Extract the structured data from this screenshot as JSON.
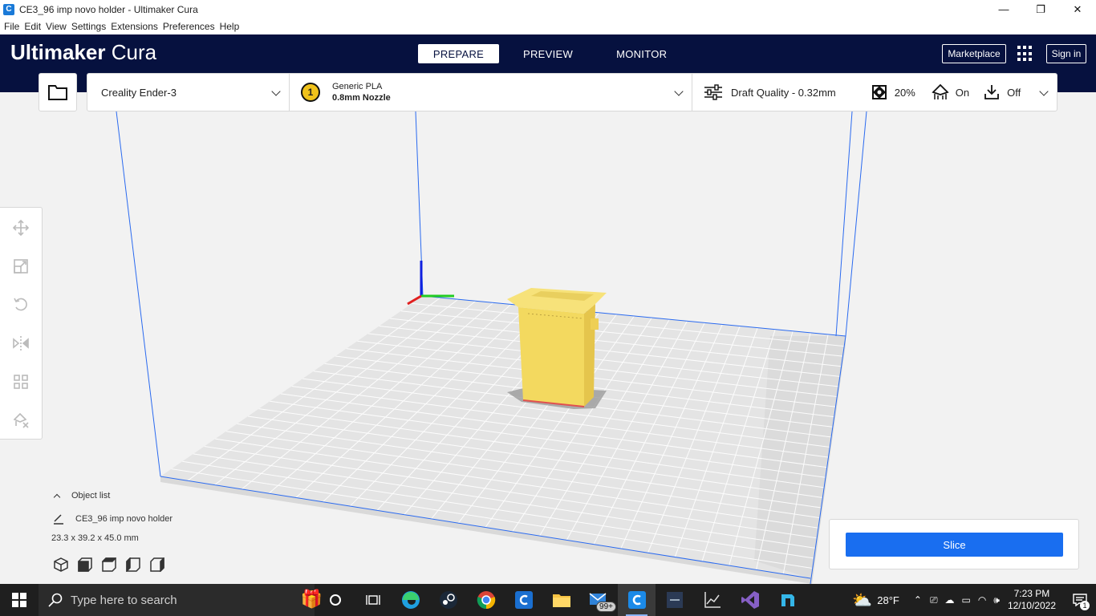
{
  "window": {
    "title": "CE3_96 imp novo holder - Ultimaker Cura",
    "minimize": "—",
    "maximize": "❐",
    "close": "✕"
  },
  "menu": {
    "items": [
      "File",
      "Edit",
      "View",
      "Settings",
      "Extensions",
      "Preferences",
      "Help"
    ]
  },
  "header": {
    "brand_bold": "Ultimaker",
    "brand_light": "Cura",
    "tabs": [
      "PREPARE",
      "PREVIEW",
      "MONITOR"
    ],
    "marketplace": "Marketplace",
    "sign_in": "Sign in"
  },
  "printer": {
    "name": "Creality Ender-3"
  },
  "material": {
    "extruder_number": "1",
    "name": "Generic PLA",
    "nozzle": "0.8mm Nozzle"
  },
  "print_settings": {
    "profile": "Draft Quality - 0.32mm",
    "infill": "20%",
    "support": "On",
    "adhesion": "Off"
  },
  "object_list": {
    "toggle_label": "Object list",
    "object_name": "CE3_96 imp novo holder",
    "dimensions": "23.3 x 39.2 x 45.0 mm"
  },
  "slice": {
    "label": "Slice"
  },
  "taskbar": {
    "search_placeholder": "Type here to search",
    "mail_badge": "99+",
    "weather": "28°F",
    "time": "7:23 PM",
    "date": "12/10/2022",
    "notification_count": "1"
  },
  "colors": {
    "header_bg": "#06113f",
    "accent": "#196ef0",
    "model": "#f7e27a"
  }
}
